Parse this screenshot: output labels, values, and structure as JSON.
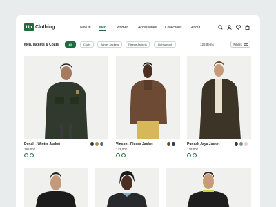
{
  "header": {
    "logo_mark": "Up",
    "logo_text": "Clothing",
    "nav": [
      {
        "label": "New In"
      },
      {
        "label": "Men",
        "active": true
      },
      {
        "label": "Women"
      },
      {
        "label": "Accessories"
      },
      {
        "label": "Collections"
      },
      {
        "label": "About"
      }
    ],
    "icons": [
      "search-icon",
      "user-icon",
      "heart-icon",
      "bag-icon"
    ]
  },
  "filters": {
    "category_title": "Men, jackets & Coats",
    "chips": [
      {
        "label": "All",
        "active": true
      },
      {
        "label": "Coats"
      },
      {
        "label": "Winter Jackets"
      },
      {
        "label": "Fleece Jackets"
      },
      {
        "label": "Lightweight"
      }
    ],
    "items_count": "126 Items",
    "filters_label": "Filters"
  },
  "products": [
    {
      "name": "Denali - Winter Jacket",
      "price": "186,00€",
      "swatches": [
        "#2f3a2c",
        "#a7874f",
        "#4b6d7f"
      ]
    },
    {
      "name": "Vinson - Fleece Jacket",
      "price": "143,00€",
      "swatches": [
        "#6d4a34",
        "#2c3a5a"
      ]
    },
    {
      "name": "Puncak Jaya Jacket",
      "price": "128,00€",
      "swatches": [
        "#3c3527",
        "#7c8b92",
        "#f0c8c2"
      ]
    }
  ],
  "colors": {
    "accent": "#1f6b3d",
    "page_bg": "#e9ecec"
  }
}
